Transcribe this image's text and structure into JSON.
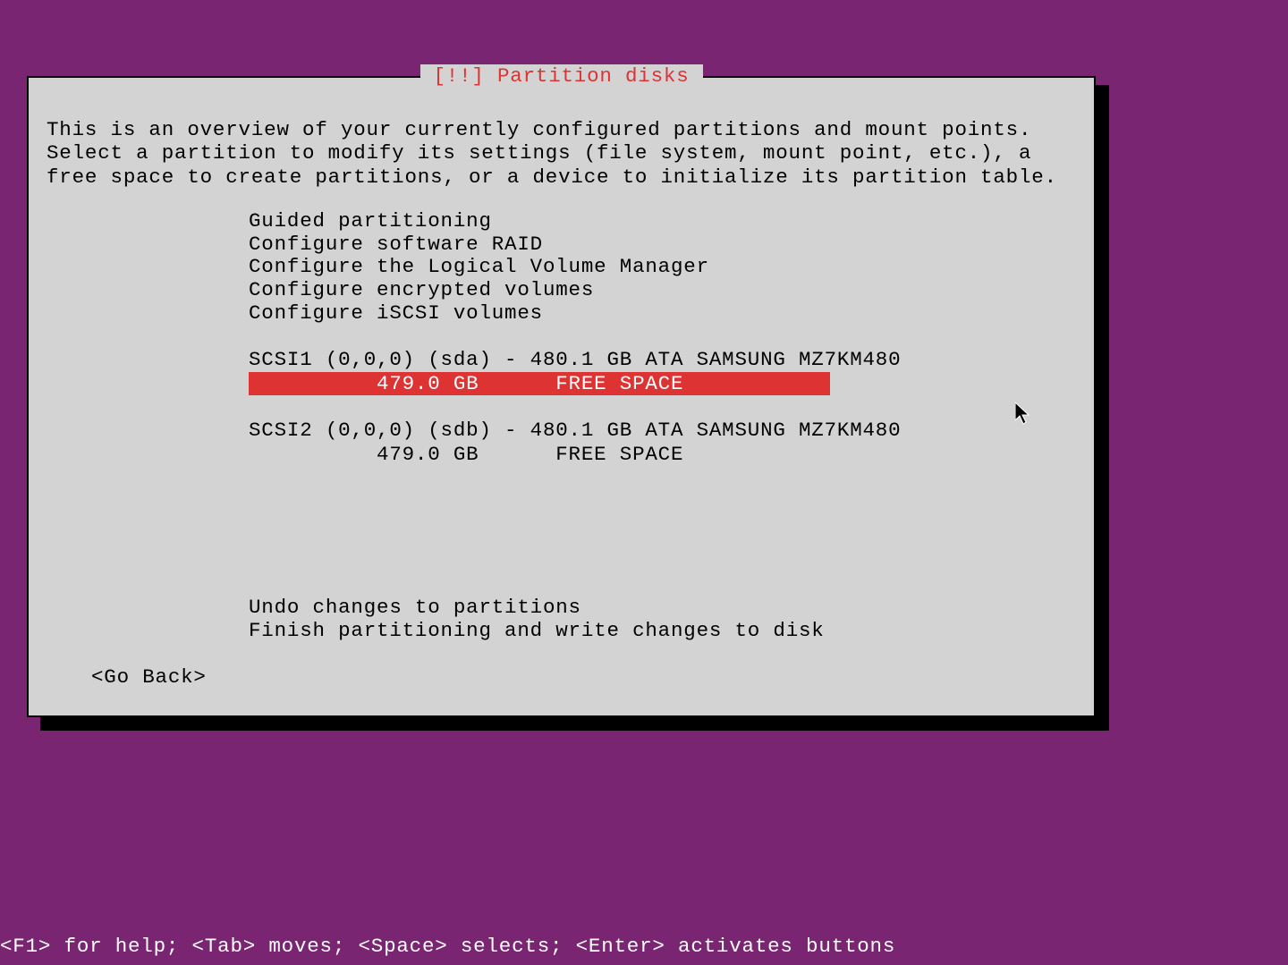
{
  "dialog": {
    "title": "[!!] Partition disks",
    "description": "This is an overview of your currently configured partitions and mount points. Select a partition to modify its settings (file system, mount point, etc.), a free space to create partitions, or a device to initialize its partition table."
  },
  "menu": {
    "guided": "Guided partitioning",
    "raid": "Configure software RAID",
    "lvm": "Configure the Logical Volume Manager",
    "encrypted": "Configure encrypted volumes",
    "iscsi": "Configure iSCSI volumes"
  },
  "disks": {
    "disk1_header": "SCSI1 (0,0,0) (sda) - 480.1 GB ATA SAMSUNG MZ7KM480",
    "disk1_free": "          479.0 GB      FREE SPACE          ",
    "disk2_header": "SCSI2 (0,0,0) (sdb) - 480.1 GB ATA SAMSUNG MZ7KM480",
    "disk2_free": "          479.0 GB      FREE SPACE"
  },
  "actions": {
    "undo": "Undo changes to partitions",
    "finish": "Finish partitioning and write changes to disk",
    "go_back": "<Go Back>"
  },
  "footer": {
    "hint": "<F1> for help; <Tab> moves; <Space> selects; <Enter> activates buttons"
  }
}
